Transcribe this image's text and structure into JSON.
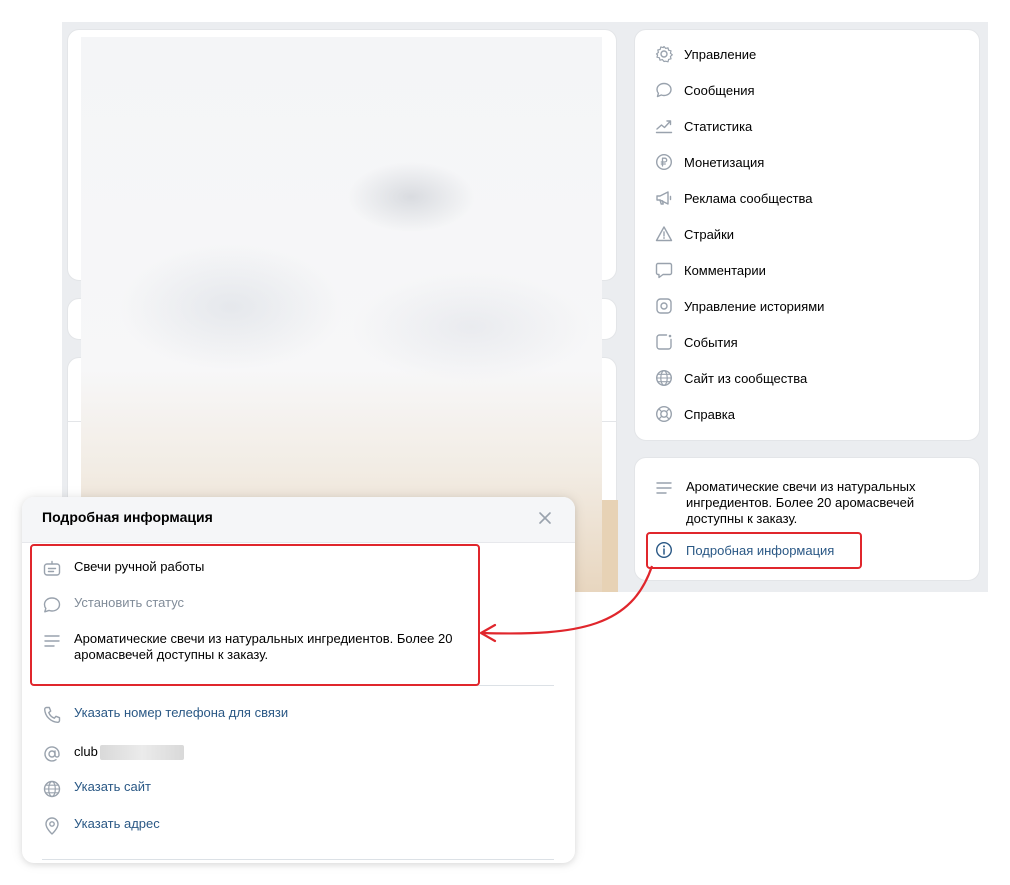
{
  "menu": {
    "items": [
      {
        "label": "Управление",
        "icon": "gear-icon"
      },
      {
        "label": "Сообщения",
        "icon": "message-icon"
      },
      {
        "label": "Статистика",
        "icon": "stats-icon"
      },
      {
        "label": "Монетизация",
        "icon": "ruble-icon"
      },
      {
        "label": "Реклама сообщества",
        "icon": "megaphone-icon"
      },
      {
        "label": "Страйки",
        "icon": "warning-icon"
      },
      {
        "label": "Комментарии",
        "icon": "comment-icon"
      },
      {
        "label": "Управление историями",
        "icon": "stories-icon"
      },
      {
        "label": "События",
        "icon": "event-icon"
      },
      {
        "label": "Сайт из сообщества",
        "icon": "globe-icon"
      },
      {
        "label": "Справка",
        "icon": "help-icon"
      }
    ]
  },
  "info_card": {
    "description": "Ароматические свечи из натуральных ингредиентов. Более 20 аромасвечей доступны к заказу.",
    "details_link": "Подробная информация"
  },
  "modal": {
    "title": "Подробная информация",
    "category": "Свечи ручной работы",
    "status_placeholder": "Установить статус",
    "description": "Ароматические свечи из натуральных ингредиентов. Более 20 аромасвечей доступны к заказу.",
    "phone_link": "Указать номер телефона для связи",
    "address_prefix": "club",
    "site_link": "Указать сайт",
    "address_link": "Указать адрес"
  },
  "colors": {
    "accent_link": "#2a5885",
    "highlight": "#e0262c"
  }
}
